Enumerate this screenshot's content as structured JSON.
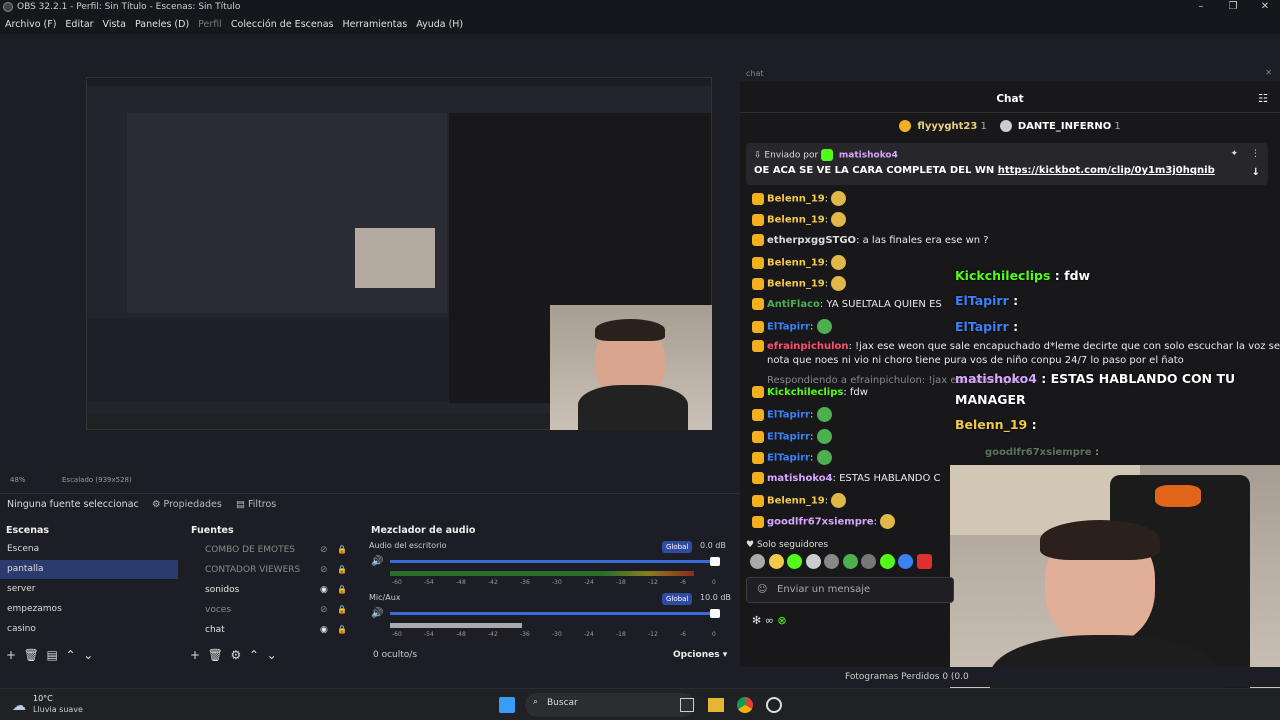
{
  "window": {
    "title": "OBS 32.2.1 - Perfil: Sin Título - Escenas: Sin Título"
  },
  "menu": [
    "Archivo (F)",
    "Editar",
    "Vista",
    "Paneles (D)",
    "Perfil",
    "Colección de Escenas",
    "Herramientas",
    "Ayuda (H)"
  ],
  "preview": {
    "zoom": "48%",
    "scale": "Escalado (939x528)"
  },
  "chat": {
    "dock_label": "chat",
    "title": "Chat",
    "top": [
      {
        "name": "flyyyght23",
        "count": "1"
      },
      {
        "name": "DANTE_INFERNO",
        "count": "1"
      }
    ],
    "pinned": {
      "sent_by": "Enviado por",
      "user": "matishoko4",
      "text": "OE ACA SE VE LA CARA COMPLETA DEL WN",
      "link": "https://kickbot.com/clip/0y1m3j0hqnib"
    },
    "messages": [
      {
        "user": "Belenn_19",
        "text": "",
        "color": "#f2c94c"
      },
      {
        "user": "Belenn_19",
        "text": "",
        "color": "#f2c94c"
      },
      {
        "user": "etherpxggSTGO",
        "text": "a las finales era ese wn ?",
        "color": "#dddddd"
      },
      {
        "user": "Belenn_19",
        "text": "",
        "color": "#f2c94c"
      },
      {
        "user": "Belenn_19",
        "text": "",
        "color": "#f2c94c"
      },
      {
        "user": "AntiFlaco",
        "text": "YA SUELTALA QUIEN ES",
        "color": "#4caf50"
      },
      {
        "user": "ElTapirr",
        "text": "",
        "color": "#3b82f6"
      },
      {
        "user": "efrainpichulon",
        "text": "!jax ese weon que sale encapuchado d*leme decirte que con solo escuchar la voz se",
        "color": "#ff4d6d"
      },
      {
        "user": "",
        "text": "nota que noes ni vio ni choro tiene pura vos de niño conpu 24/7 lo paso por el ñato",
        "color": "#eaeaea"
      },
      {
        "user": "",
        "text": "Respondiendo a efrainpichulon: !jax ese weon que",
        "color": "#888888"
      },
      {
        "user": "Kickchileclips",
        "text": "fdw",
        "color": "#53fc18"
      },
      {
        "user": "ElTapirr",
        "text": "",
        "color": "#3b82f6"
      },
      {
        "user": "ElTapirr",
        "text": "",
        "color": "#3b82f6"
      },
      {
        "user": "ElTapirr",
        "text": "",
        "color": "#3b82f6"
      },
      {
        "user": "matishoko4",
        "text": "ESTAS HABLANDO C",
        "color": "#d8a6ff"
      },
      {
        "user": "Belenn_19",
        "text": "",
        "color": "#f2c94c"
      },
      {
        "user": "goodlfr67xsiempre",
        "text": "",
        "color": "#d8a6ff"
      }
    ],
    "overlay": [
      {
        "user": "Kickchileclips",
        "text": "fdw",
        "color": "#53fc18"
      },
      {
        "user": "ElTapirr",
        "text": "",
        "color": "#3b82f6"
      },
      {
        "user": "ElTapirr",
        "text": "",
        "color": "#3b82f6"
      },
      {
        "user": "matishoko4",
        "text": "ESTAS HABLANDO CON TU",
        "color": "#d8a6ff"
      },
      {
        "user": "",
        "text": "MANAGER",
        "color": "#ffffff"
      },
      {
        "user": "Belenn_19",
        "text": "",
        "color": "#f2c94c"
      },
      {
        "user": "goodlfr67xsiempre",
        "text": "",
        "color": "#9ad0a2"
      }
    ],
    "followers_only": "Solo seguidores",
    "input_placeholder": "Enviar un mensaje"
  },
  "source_bar": {
    "none_selected": "Ninguna fuente seleccionac",
    "properties": "Propiedades",
    "filters": "Filtros"
  },
  "scenes": {
    "title": "Escenas",
    "items": [
      "Escena",
      "pantalla",
      "server",
      "empezamos",
      "casino"
    ],
    "active": "pantalla"
  },
  "sources": {
    "title": "Fuentes",
    "items": [
      {
        "name": "COMBO DE EMOTES",
        "visible": false
      },
      {
        "name": "CONTADOR VIEWERS",
        "visible": false
      },
      {
        "name": "sonidos",
        "visible": true
      },
      {
        "name": "voces",
        "visible": false
      },
      {
        "name": "chat",
        "visible": true
      }
    ]
  },
  "mixer": {
    "title": "Mezclador de audio",
    "channels": [
      {
        "name": "Audio del escritorio",
        "db": "0.0 dB",
        "volume": 1.0,
        "level": 0.92
      },
      {
        "name": "Mic/Aux",
        "db": "10.0 dB",
        "volume": 1.0,
        "level": 0.4
      }
    ],
    "global": "Global",
    "ticks": [
      "-60",
      "-54",
      "-48",
      "-42",
      "-36",
      "-30",
      "-24",
      "-18",
      "-12",
      "-6",
      "0"
    ],
    "hidden": "0 oculto/s",
    "options": "Opciones"
  },
  "status": {
    "frames": "Fotogramas Perdidos 0 (0.0"
  },
  "taskbar": {
    "temp": "10°C",
    "weather": "Lluvia suave",
    "search": "Buscar"
  }
}
